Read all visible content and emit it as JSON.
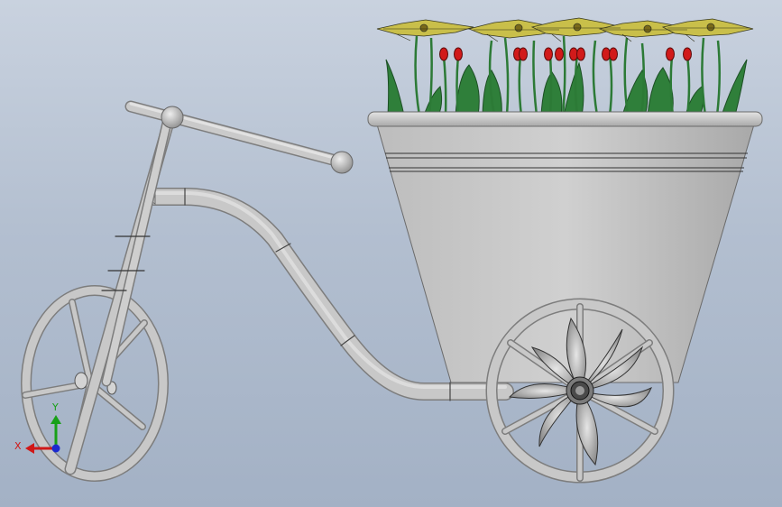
{
  "viewport": {
    "background_top": "#c9d2df",
    "background_bottom": "#a3b1c5"
  },
  "model": {
    "tube_color": "#c4c4c4",
    "pot_color": "#c2c2c2",
    "leaf_color": "#2f7f3a",
    "tulip_color": "#d11a1a",
    "daisy_color": "#c9bf4a"
  },
  "triad": {
    "x_label": "X",
    "y_label": "Y",
    "x_color": "#d01818",
    "y_color": "#18a018",
    "z_color": "#1c2ad0"
  }
}
